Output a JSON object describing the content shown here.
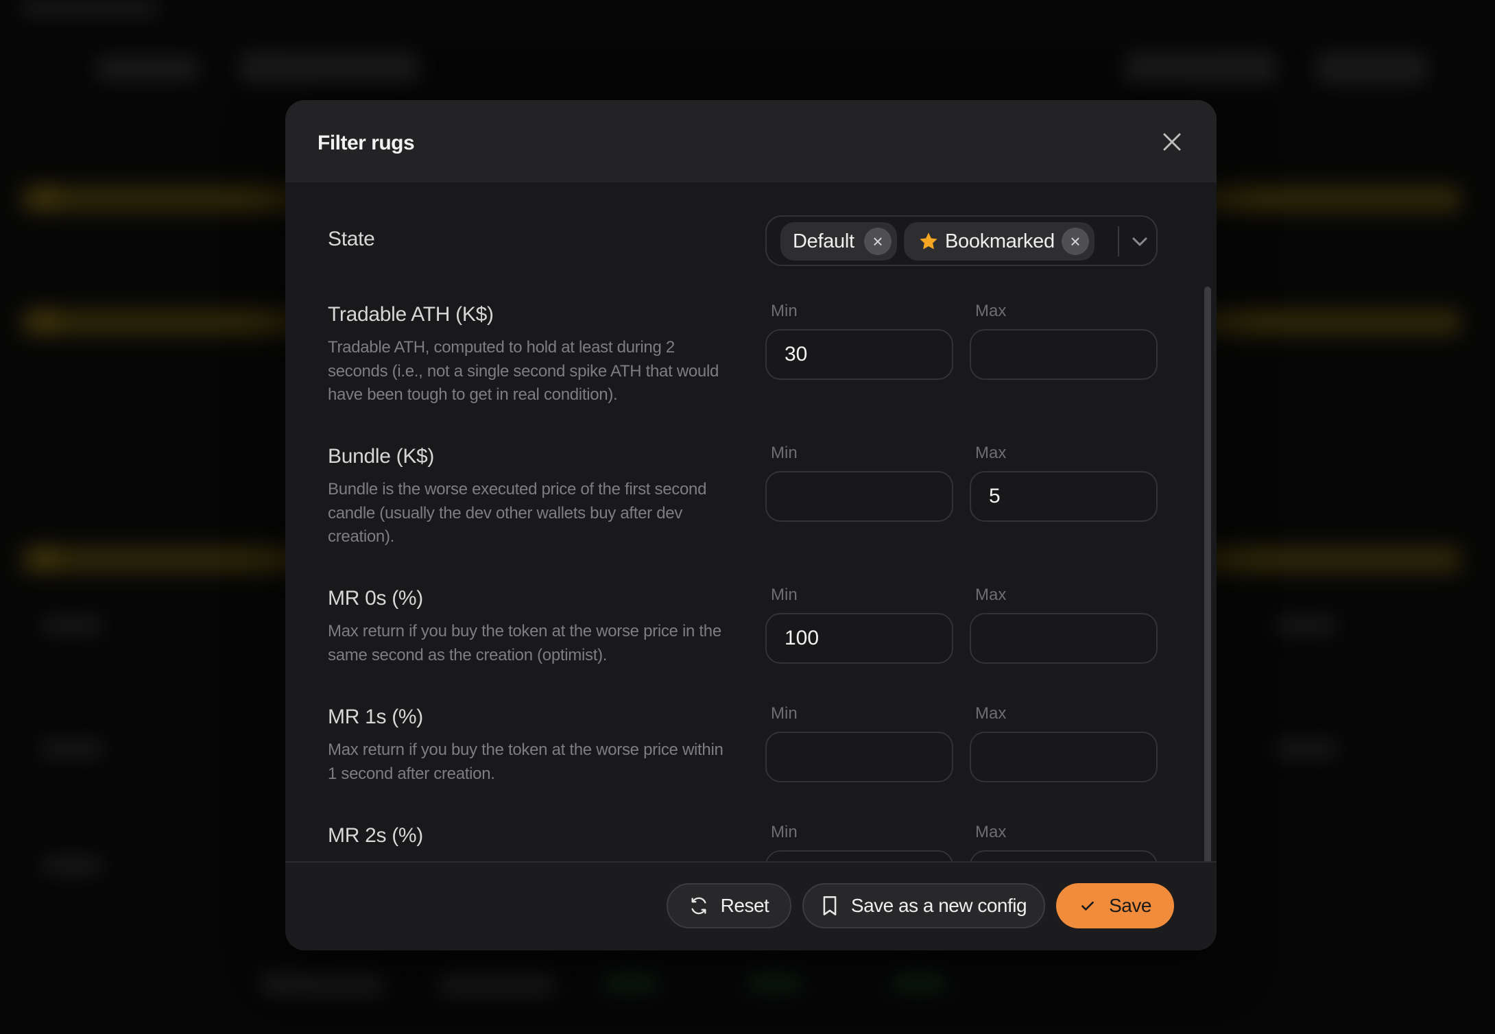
{
  "modal": {
    "title": "Filter rugs"
  },
  "state": {
    "label": "State",
    "chips": [
      {
        "label": "Default",
        "icon": "none"
      },
      {
        "label": "Bookmarked",
        "icon": "star-icon"
      }
    ],
    "remove_glyph": "×"
  },
  "filters": [
    {
      "title": "Tradable ATH (K$)",
      "description": "Tradable ATH, computed to hold at least during 2 seconds (i.e., not a single second spike ATH that would have been tough to get in real condition).",
      "min_label": "Min",
      "max_label": "Max",
      "min_value": "30",
      "max_value": ""
    },
    {
      "title": "Bundle (K$)",
      "description": "Bundle is the worse executed price of the first second candle (usually the dev other wallets buy after dev creation).",
      "min_label": "Min",
      "max_label": "Max",
      "min_value": "",
      "max_value": "5"
    },
    {
      "title": "MR 0s (%)",
      "description": "Max return if you buy the token at the worse price in the same second as the creation (optimist).",
      "min_label": "Min",
      "max_label": "Max",
      "min_value": "100",
      "max_value": ""
    },
    {
      "title": "MR 1s (%)",
      "description": "Max return if you buy the token at the worse price within 1 second after creation.",
      "min_label": "Min",
      "max_label": "Max",
      "min_value": "",
      "max_value": ""
    },
    {
      "title": "MR 2s (%)",
      "description": "",
      "min_label": "Min",
      "max_label": "Max",
      "min_value": "",
      "max_value": ""
    }
  ],
  "footer": {
    "reset_label": "Reset",
    "save_config_label": "Save as a new config",
    "save_label": "Save"
  },
  "colors": {
    "accent": "#f08c3b",
    "star": "#f5a623",
    "modal_bg": "#19191b",
    "header_bg": "#232325"
  }
}
